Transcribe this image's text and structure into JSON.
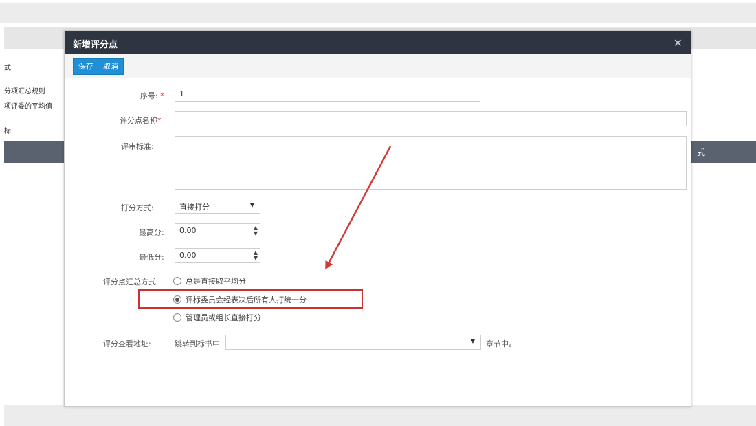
{
  "background": {
    "left_texts": [
      "式",
      "分项汇总规则",
      "项评委的平均值",
      "标"
    ],
    "dark_bar_label": "式"
  },
  "dialog": {
    "title": "新增评分点",
    "close_icon": "✕",
    "toolbar": {
      "save_label": "保存",
      "cancel_label": "取消"
    },
    "fields": {
      "seq": {
        "label": "序号:",
        "required_mark": "*",
        "value": "1"
      },
      "name": {
        "label": "评分点名称",
        "required_mark": "*",
        "value": ""
      },
      "criteria": {
        "label": "评审标准:",
        "value": ""
      },
      "scoring_method": {
        "label": "打分方式:",
        "value": "直接打分"
      },
      "max_score": {
        "label": "最高分:",
        "value": "0.00"
      },
      "min_score": {
        "label": "最低分:",
        "value": "0.00"
      },
      "summary": {
        "label": "评分点汇总方式",
        "options": [
          "总是直接取平均分",
          "评标委员会经表决后所有人打统一分",
          "管理员或组长直接打分"
        ],
        "selected_index": 1
      },
      "view_address": {
        "label": "评分查看地址:",
        "prefix": "跳转到标书中",
        "value": "",
        "suffix": "章节中。"
      }
    }
  },
  "colors": {
    "titlebar": "#2e3440",
    "button": "#1f8fd6",
    "highlight": "#c9322e",
    "arrow": "#d33a35"
  }
}
